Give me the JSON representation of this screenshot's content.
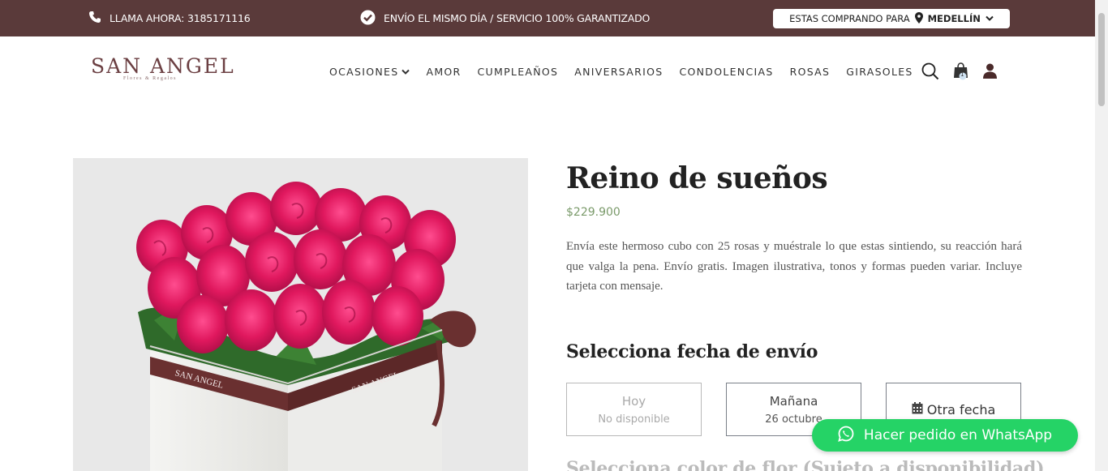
{
  "topbar": {
    "phone_label": "LLAMA AHORA: 3185171116",
    "shipping_label": "ENVÍO EL MISMO DÍA / SERVICIO 100% GARANTIZADO",
    "city_prefix": "ESTAS COMPRANDO PARA",
    "city_value": "MEDELLÍN"
  },
  "header": {
    "logo_main": "SAN ANGEL",
    "logo_sub": "Flores & Regalos",
    "nav": [
      {
        "label": "OCASIONES"
      },
      {
        "label": "AMOR"
      },
      {
        "label": "CUMPLEAÑOS"
      },
      {
        "label": "ANIVERSARIOS"
      },
      {
        "label": "CONDOLENCIAS"
      },
      {
        "label": "ROSAS"
      },
      {
        "label": "GIRASOLES"
      }
    ],
    "cart_count": "1",
    "icons": [
      "search-icon",
      "cart-icon",
      "user-icon"
    ]
  },
  "product": {
    "title": "Reino de sueños",
    "price": "$229.900",
    "description": "Envía este hermoso cubo con 25 rosas y muéstrale lo que estas sintiendo, su reacción hará que valga la pena. Envío gratis. Imagen ilustrativa, tonos y formas pueden variar. Incluye tarjeta con mensaje.",
    "box_brand": "SAN ANGEL"
  },
  "delivery": {
    "heading": "Selecciona fecha de envío",
    "options": [
      {
        "main": "Hoy",
        "sub": "No disponible"
      },
      {
        "main": "Mañana",
        "sub": "26 octubre"
      },
      {
        "main": "Otra fecha",
        "sub": ""
      }
    ]
  },
  "color_heading": "Selecciona color de flor (Sujeto a disponibilidad)",
  "whatsapp_button": "Hacer pedido en WhatsApp",
  "colors": {
    "topbar_bg": "#5a3a3a",
    "price": "#7a9a6a",
    "whatsapp": "#25d366",
    "roses": "#e0185e"
  }
}
